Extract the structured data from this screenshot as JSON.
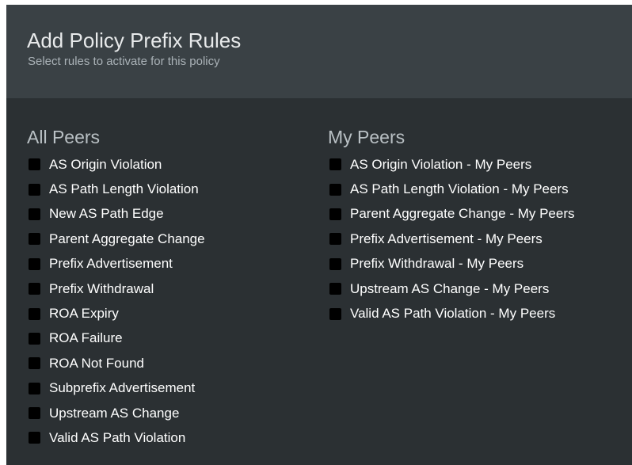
{
  "dialog": {
    "title": "Add Policy Prefix Rules",
    "subtitle": "Select rules to activate for this policy"
  },
  "all_peers": {
    "title": "All Peers",
    "rules": [
      {
        "label": "AS Origin Violation",
        "checked": false
      },
      {
        "label": "AS Path Length Violation",
        "checked": false
      },
      {
        "label": "New AS Path Edge",
        "checked": false
      },
      {
        "label": "Parent Aggregate Change",
        "checked": false
      },
      {
        "label": "Prefix Advertisement",
        "checked": false
      },
      {
        "label": "Prefix Withdrawal",
        "checked": false
      },
      {
        "label": "ROA Expiry",
        "checked": false
      },
      {
        "label": "ROA Failure",
        "checked": false
      },
      {
        "label": "ROA Not Found",
        "checked": false
      },
      {
        "label": "Subprefix Advertisement",
        "checked": false
      },
      {
        "label": "Upstream AS Change",
        "checked": false
      },
      {
        "label": "Valid AS Path Violation",
        "checked": false
      }
    ]
  },
  "my_peers": {
    "title": "My Peers",
    "rules": [
      {
        "label": "AS Origin Violation - My Peers",
        "checked": false
      },
      {
        "label": "AS Path Length Violation - My Peers",
        "checked": false
      },
      {
        "label": "Parent Aggregate Change - My Peers",
        "checked": false
      },
      {
        "label": "Prefix Advertisement - My Peers",
        "checked": false
      },
      {
        "label": "Prefix Withdrawal - My Peers",
        "checked": false
      },
      {
        "label": "Upstream AS Change - My Peers",
        "checked": false
      },
      {
        "label": "Valid AS Path Violation - My Peers",
        "checked": false
      }
    ]
  },
  "colors": {
    "header_background": "#3a4145",
    "body_background": "#2b3033",
    "checkbox": "#000000",
    "text": "#ffffff"
  }
}
